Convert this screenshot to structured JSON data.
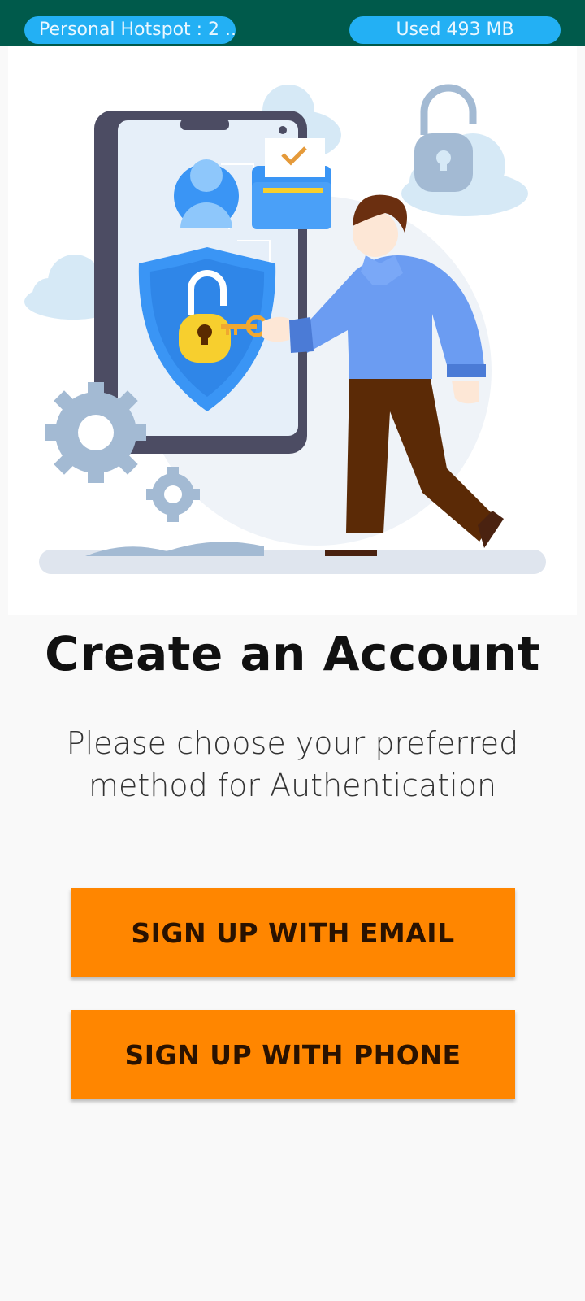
{
  "status_bar": {
    "hotspot_label": "Personal Hotspot : 2 ...",
    "data_usage_label": "Used  493 MB"
  },
  "illustration": {
    "icons": [
      "phone-icon",
      "user-icon",
      "folder-icon",
      "shield-lock-icon",
      "key-icon",
      "padlock-icon",
      "gear-icon",
      "cloud-icon",
      "person-figure"
    ],
    "colors": {
      "accent_blue": "#3a95f5",
      "lock_yellow": "#f7cf2e",
      "gear_gray": "#a3bad3"
    }
  },
  "main": {
    "title": "Create an Account",
    "subtitle": "Please choose your preferred method for Authentication",
    "email_button_label": "SIGN UP WITH EMAIL",
    "phone_button_label": "SIGN UP WITH PHONE"
  },
  "colors": {
    "status_bar_bg": "#005a4b",
    "pill_bg": "#23b0f4",
    "button_bg": "#ff8600",
    "button_text": "#2a1200",
    "page_bg": "#f9f9f9"
  }
}
